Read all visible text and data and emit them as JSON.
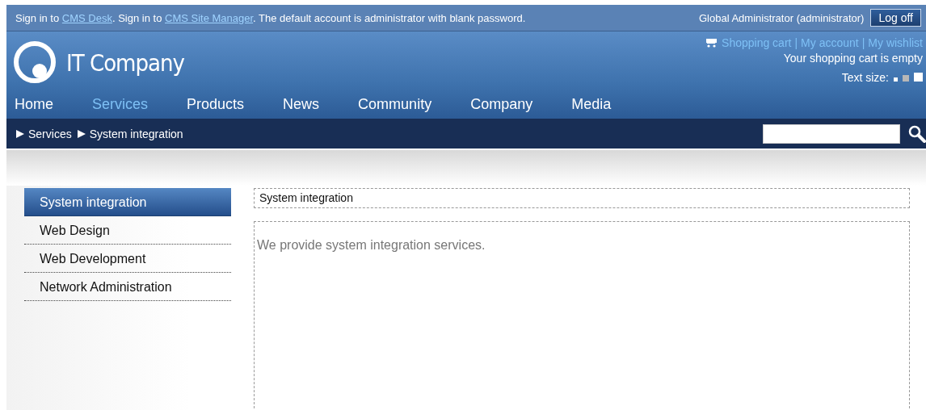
{
  "top_bar": {
    "message": [
      {
        "kind": "text",
        "text": "Sign in to "
      },
      {
        "kind": "link",
        "text": "CMS Desk"
      },
      {
        "kind": "text",
        "text": ". Sign in to "
      },
      {
        "kind": "link",
        "text": "CMS Site Manager"
      },
      {
        "kind": "text",
        "text": ". The default account is administrator with blank password."
      }
    ],
    "user": "Global Administrator (administrator)",
    "logoff": "Log off"
  },
  "header": {
    "logo": "IT Company",
    "links": [
      "Shopping cart",
      "My account",
      "My wishlist"
    ],
    "link_separators": [
      "|",
      "|"
    ],
    "cart_status": "Your shopping cart is empty",
    "text_size_label": "Text size:",
    "text_sizes": [
      {
        "selected": false
      },
      {
        "selected": true
      },
      {
        "selected": false
      }
    ]
  },
  "nav": [
    {
      "label": "Home",
      "selected": false
    },
    {
      "label": "Services",
      "selected": true
    },
    {
      "label": "Products",
      "selected": false
    },
    {
      "label": "News",
      "selected": false
    },
    {
      "label": "Community",
      "selected": false
    },
    {
      "label": "Company",
      "selected": false
    },
    {
      "label": "Media",
      "selected": false
    }
  ],
  "breadcrumb": [
    "Services",
    "System integration"
  ],
  "sidebar": [
    {
      "label": "System integration",
      "selected": true
    },
    {
      "label": "Web Design",
      "selected": false
    },
    {
      "label": "Web Development",
      "selected": false
    },
    {
      "label": "Network Administration",
      "selected": false
    }
  ],
  "content": {
    "title": "System integration",
    "text": "We provide system integration services."
  }
}
